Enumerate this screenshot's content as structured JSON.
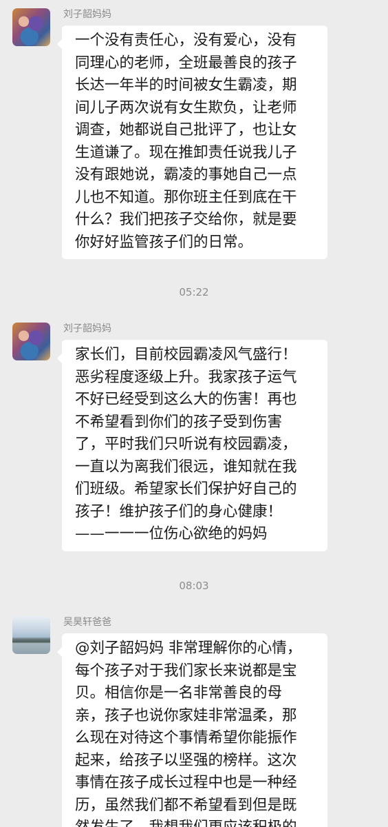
{
  "messages": [
    {
      "sender": "刘子韶妈妈",
      "avatar": "portrait-avatar",
      "lines": [
        "一个没有责任心，没有爱心，没有",
        "同理心的老师，全班最善良的孩子",
        "长达一年半的时间被女生霸凌，期",
        "间儿子两次说有女生欺负，让老师",
        "调查，她都说自己批评了，也让女",
        "生道谦了。现在推卸责任说我儿子",
        "没有跟她说，霸凌的事她自己一点",
        "儿也不知道。那你班主任到底在干",
        "什么？我们把孩子交给你，就是要",
        "你好好监管孩子们的日常。"
      ]
    },
    {
      "sender": "刘子韶妈妈",
      "avatar": "portrait-avatar",
      "lines": [
        "家长们，目前校园霸凌风气盛行！",
        "恶劣程度逐级上升。我家孩子运气",
        "不好已经受到这么大的伤害！再也",
        "不希望看到你们的孩子受到伤害",
        "了，平时我们只听说有校园霸凌，",
        "一直以为离我们很远，谁知就在我",
        "们班级。希望家长们保护好自己的",
        "孩子！维护孩子们的身心健康！",
        "——一一一位伤心欲绝的妈妈"
      ]
    },
    {
      "sender": "吴昊轩爸爸",
      "avatar": "landscape-avatar",
      "lines": [
        "@刘子韶妈妈  非常理解你的心情，",
        "每个孩子对于我们家长来说都是宝",
        "贝。相信你是一名非常善良的母",
        "亲，孩子也说你家娃非常温柔，那",
        "么现在对待这个事情希望你能振作",
        "起来，给孩子以坚强的榜样。这次",
        "事情在孩子成长过程中也是一种经",
        "历，虽然我们都不希望看到但是既",
        "然发生了，我想我们更应该积极的"
      ]
    }
  ],
  "timestamps": [
    "05:22",
    "08:03"
  ],
  "colors": {
    "background": "#ececec",
    "bubble": "#ffffff",
    "sender_name": "#8a8a8a",
    "timestamp": "#8c8c8c",
    "text": "#1b1b1b"
  }
}
